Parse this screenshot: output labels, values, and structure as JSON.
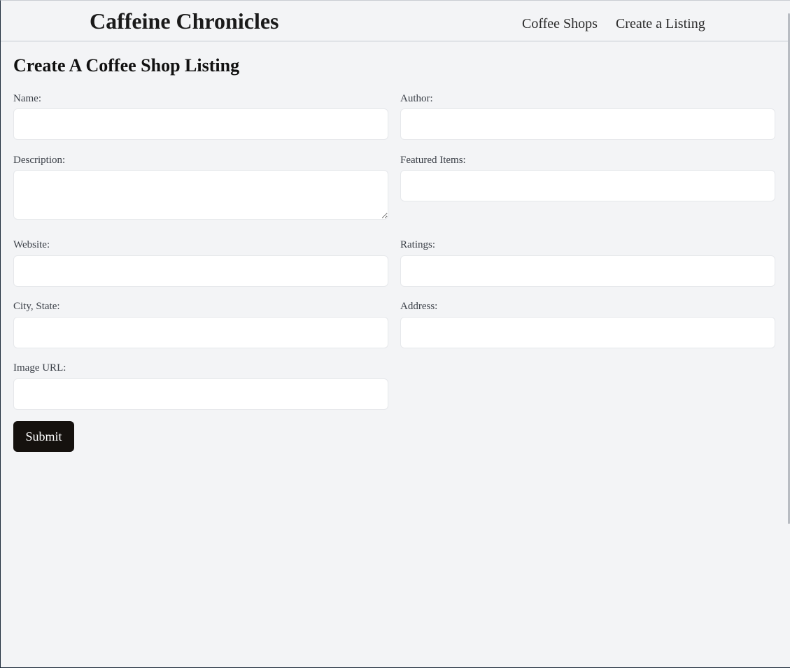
{
  "header": {
    "site_title": "Caffeine Chronicles",
    "nav": [
      "Coffee Shops",
      "Create a Listing"
    ]
  },
  "page": {
    "heading": "Create A Coffee Shop Listing"
  },
  "form": {
    "name": {
      "label": "Name:",
      "value": ""
    },
    "author": {
      "label": "Author:",
      "value": ""
    },
    "description": {
      "label": "Description:",
      "value": ""
    },
    "featured_items": {
      "label": "Featured Items:",
      "value": ""
    },
    "website": {
      "label": "Website:",
      "value": ""
    },
    "ratings": {
      "label": "Ratings:",
      "value": ""
    },
    "city_state": {
      "label": "City, State:",
      "value": ""
    },
    "address": {
      "label": "Address:",
      "value": ""
    },
    "image_url": {
      "label": "Image URL:",
      "value": ""
    },
    "submit_label": "Submit"
  }
}
